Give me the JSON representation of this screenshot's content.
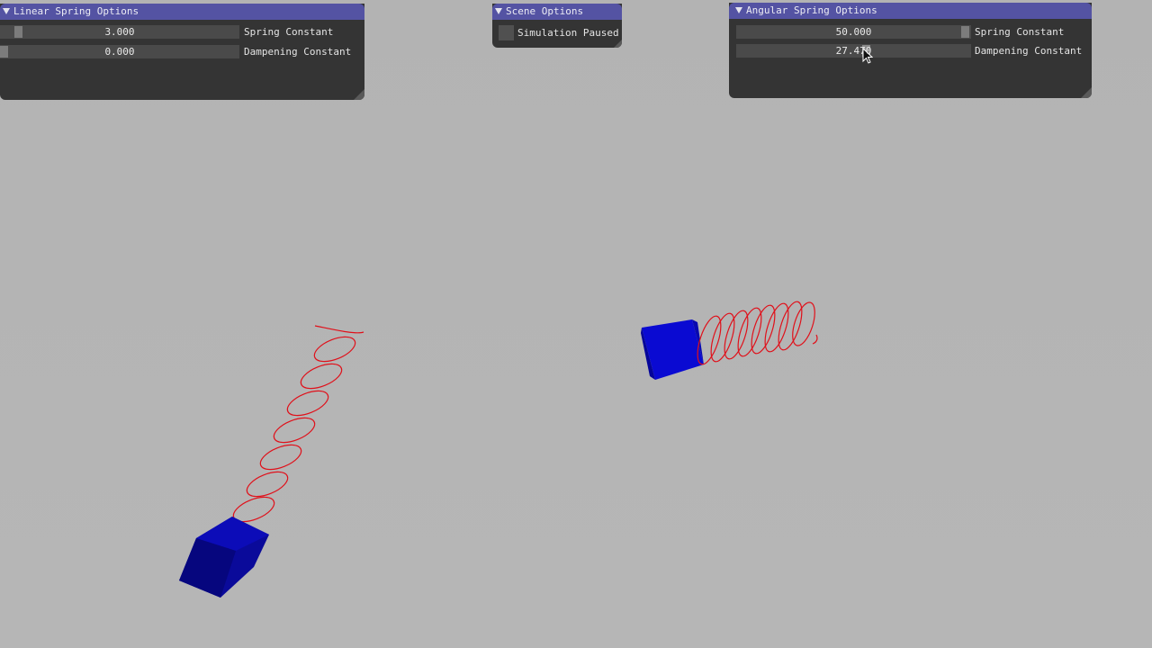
{
  "linear_panel": {
    "title": "Linear Spring Options",
    "spring_constant": {
      "label": "Spring Constant",
      "value": "3.000",
      "level": 0.06
    },
    "dampening_constant": {
      "label": "Dampening Constant",
      "value": "0.000",
      "level": 0.0
    }
  },
  "scene_panel": {
    "title": "Scene Options",
    "paused_label": "Simulation Paused",
    "paused": false
  },
  "angular_panel": {
    "title": "Angular Spring Options",
    "spring_constant": {
      "label": "Spring Constant",
      "value": "50.000",
      "level": 1.0
    },
    "dampening_constant": {
      "label": "Dampening Constant",
      "value": "27.470",
      "level": 0.55
    }
  },
  "colors": {
    "background": "#b4b4b4",
    "panel_bg": "#343434",
    "title_bar": "#5453a3",
    "slider_bg": "#4a4a4a",
    "slider_grab": "#7c7c7c",
    "spring": "#e0101a",
    "cube": "#0a0ad2",
    "cube_dark": "#05057f"
  },
  "icons": [
    "collapse-arrow-icon",
    "resize-grip-icon",
    "mouse-cursor-icon",
    "checkbox-icon"
  ]
}
